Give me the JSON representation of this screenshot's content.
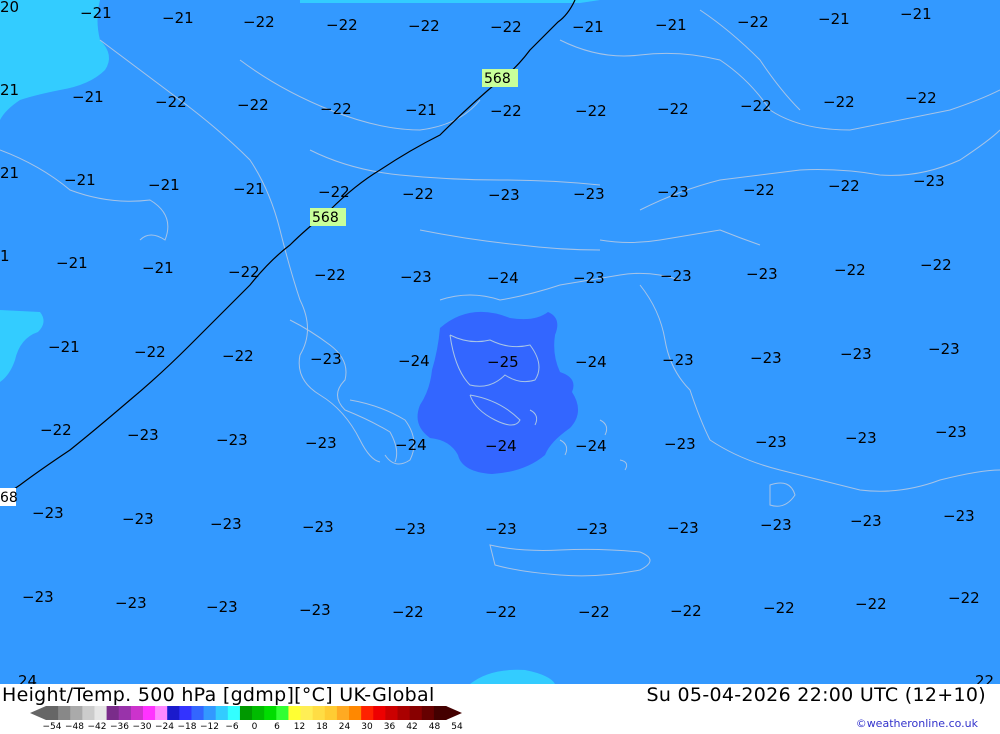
{
  "map": {
    "background_color": "#3399ff",
    "cold_region_color": "#3366ff",
    "warm_region_color": "#33ccff",
    "coastline_color": "#a8c4e6",
    "contour_color": "#000000",
    "contour_labels": [
      "568",
      "568",
      "68"
    ],
    "temperature_labels": [
      "20",
      "-21",
      "-21",
      "-22",
      "-22",
      "-22",
      "-22",
      "-21",
      "-21",
      "-22",
      "-21",
      "-21",
      "21",
      "-21",
      "-22",
      "-22",
      "-22",
      "-21",
      "-22",
      "-22",
      "-22",
      "-22",
      "-22",
      "-22",
      "21",
      "-21",
      "-21",
      "-21",
      "-22",
      "-22",
      "-23",
      "-23",
      "-23",
      "-22",
      "-22",
      "-23",
      "1",
      "-21",
      "-21",
      "-22",
      "-22",
      "-23",
      "-24",
      "-23",
      "-23",
      "-23",
      "-22",
      "-22",
      "-21",
      "-22",
      "-22",
      "-23",
      "-24",
      "-25",
      "-24",
      "-23",
      "-23",
      "-23",
      "-23",
      "-22",
      "-23",
      "-23",
      "-23",
      "-24",
      "-24",
      "-24",
      "-23",
      "-23",
      "-23",
      "-23",
      "-23",
      "-23",
      "-23",
      "-23",
      "-23",
      "-23",
      "-23",
      "-23",
      "-23",
      "-23",
      "-23",
      "-23",
      "-23",
      "-23",
      "-23",
      "-22",
      "-22",
      "-22",
      "-22",
      "-22",
      "-22",
      "-22",
      "24",
      "22"
    ]
  },
  "footer": {
    "title": "Height/Temp. 500 hPa [gdmp][°C] UK-Global",
    "datetime": "Su 05-04-2026 22:00 UTC (12+10)",
    "credit": "©weatheronline.co.uk"
  },
  "scale": {
    "colors": [
      "#666666",
      "#888888",
      "#aaaaaa",
      "#cccccc",
      "#e6e6e6",
      "#7a2c8a",
      "#9933aa",
      "#cc33cc",
      "#ff33ff",
      "#ff88ff",
      "#1a1acc",
      "#3333ff",
      "#3366ff",
      "#3399ff",
      "#33ccff",
      "#33ffff",
      "#009900",
      "#00bb00",
      "#00dd00",
      "#33ff33",
      "#ffff33",
      "#ffee55",
      "#ffdd44",
      "#ffcc33",
      "#ffaa22",
      "#ff8800",
      "#ff2200",
      "#ee0000",
      "#cc0000",
      "#aa0000",
      "#880000",
      "#660000",
      "#440000"
    ],
    "tick_labels": [
      "-54",
      "-48",
      "-42",
      "-36",
      "-30",
      "-24",
      "-18",
      "-12",
      "-6",
      "0",
      "6",
      "12",
      "18",
      "24",
      "30",
      "36",
      "42",
      "48",
      "54"
    ]
  }
}
